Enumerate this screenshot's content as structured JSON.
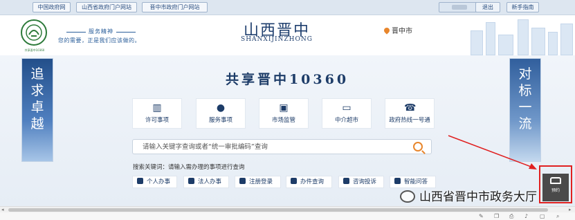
{
  "top_links": [
    "中国政府网",
    "山西省政府门户网站",
    "晋中市政府门户网站"
  ],
  "top_buttons": {
    "exit": "退出",
    "guide": "新手指南"
  },
  "header": {
    "logo_caption": "共享晋中10360",
    "motto_title": "服务精神",
    "motto_text": "您的需要，正是我们应该做的。",
    "site_title": "山西晋中",
    "site_subtitle": "SHANXIJINZHONG",
    "city": "晋中市"
  },
  "banners": {
    "left": [
      "追",
      "求",
      "卓",
      "越"
    ],
    "right": [
      "对",
      "标",
      "一",
      "流"
    ]
  },
  "main": {
    "title": "共享晋中10360",
    "services": [
      {
        "label": "许可事项",
        "icon": "building-icon"
      },
      {
        "label": "服务事项",
        "icon": "person-icon"
      },
      {
        "label": "市场监管",
        "icon": "save-icon"
      },
      {
        "label": "中介超市",
        "icon": "monitor-icon"
      },
      {
        "label": "政府热线一号通",
        "icon": "phone-icon"
      }
    ],
    "search_placeholder": "请输入关键字查询或者“统一审批编码”查询",
    "keywords_label": "搜索关键词：请输入需办理的事项进行查询",
    "quick_buttons": [
      "个人办事",
      "法人办事",
      "注册登录",
      "办件查询",
      "咨询投诉",
      "智能问答"
    ]
  },
  "booking_button": "预约",
  "watermark": "山西省晋中市政务大厅",
  "colors": {
    "accent": "#1d3c68",
    "highlight": "#e02020",
    "orange": "#e8862c"
  }
}
